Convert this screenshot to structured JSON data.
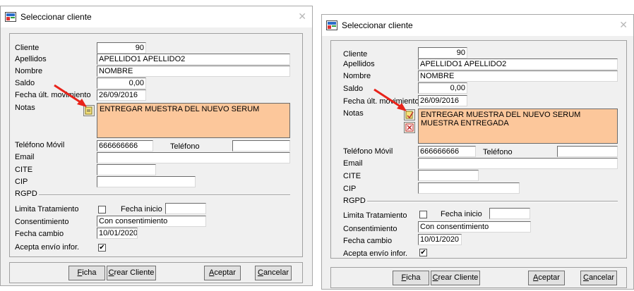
{
  "left": {
    "window_title": "Seleccionar cliente",
    "close_glyph": "✕",
    "labels": {
      "cliente": "Cliente",
      "apellidos": "Apellidos",
      "nombre": "Nombre",
      "saldo": "Saldo",
      "fecha_ult": "Fecha últ. movimiento",
      "notas": "Notas",
      "telefono_movil": "Teléfono Móvil",
      "telefono": "Teléfono",
      "email": "Email",
      "cite": "CITE",
      "cip": "CIP",
      "rgpd": "RGPD",
      "limita": "Limita Tratamiento",
      "fecha_inicio": "Fecha inicio",
      "consentimiento": "Consentimiento",
      "fecha_cambio": "Fecha cambio",
      "acepta": "Acepta envío infor."
    },
    "values": {
      "cliente": "90",
      "apellidos": "APELLIDO1 APELLIDO2",
      "nombre": "NOMBRE",
      "saldo": "0,00",
      "fecha_ult": "26/09/2016",
      "notas": "ENTREGAR MUESTRA DEL NUEVO SERUM",
      "telefono_movil": "666666666",
      "telefono": "",
      "email": "",
      "cite": "",
      "cip": "",
      "fecha_inicio": "",
      "consentimiento": "Con consentimiento",
      "fecha_cambio": "10/01/2020"
    },
    "checks": {
      "limita": "",
      "acepta": "✔"
    },
    "buttons": {
      "ficha": "Ficha",
      "crear": "Crear Cliente",
      "aceptar": "Aceptar",
      "cancelar": "Cancelar"
    }
  },
  "right": {
    "window_title": "Seleccionar cliente",
    "close_glyph": "✕",
    "labels": {
      "cliente": "Cliente",
      "apellidos": "Apellidos",
      "nombre": "Nombre",
      "saldo": "Saldo",
      "fecha_ult": "Fecha últ. movimiento",
      "notas": "Notas",
      "telefono_movil": "Teléfono Móvil",
      "telefono": "Teléfono",
      "email": "Email",
      "cite": "CITE",
      "cip": "CIP",
      "rgpd": "RGPD",
      "limita": "Limita Tratamiento",
      "fecha_inicio": "Fecha inicio",
      "consentimiento": "Consentimiento",
      "fecha_cambio": "Fecha cambio",
      "acepta": "Acepta envío infor."
    },
    "values": {
      "cliente": "90",
      "apellidos": "APELLIDO1 APELLIDO2",
      "nombre": "NOMBRE",
      "saldo": "0,00",
      "fecha_ult": "26/09/2016",
      "notas_line1": "ENTREGAR MUESTRA DEL NUEVO SERUM",
      "notas_line2": "MUESTRA ENTREGADA",
      "telefono_movil": "666666666",
      "telefono": "",
      "email": "",
      "cite": "",
      "cip": "",
      "fecha_inicio": "",
      "consentimiento": "Con consentimiento",
      "fecha_cambio": "10/01/2020"
    },
    "checks": {
      "limita": "",
      "acepta": "✔"
    },
    "buttons": {
      "ficha": "Ficha",
      "crear": "Crear Cliente",
      "aceptar": "Aceptar",
      "cancelar": "Cancelar"
    }
  },
  "colors": {
    "notes_bg": "#fcc79b",
    "annotation_arrow": "#e8231a",
    "dialog_bg": "#f0f0f0"
  },
  "icons": [
    "app-icon",
    "close-icon",
    "note-edit-icon",
    "note-delete-icon",
    "annotation-arrow"
  ]
}
